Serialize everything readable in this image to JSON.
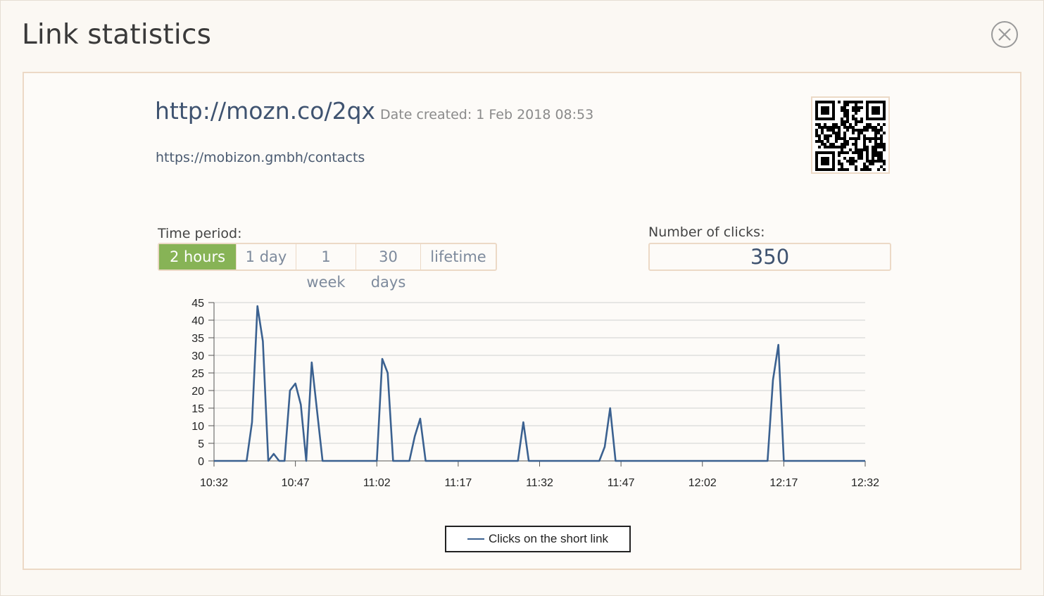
{
  "modal": {
    "title": "Link statistics"
  },
  "link": {
    "short_url": "http://mozn.co/2qx",
    "date_created": "Date created: 1 Feb 2018 08:53",
    "long_url": "https://mobizon.gmbh/contacts"
  },
  "period": {
    "label": "Time period:",
    "options": [
      "2 hours",
      "1 day",
      "1 week",
      "30 days",
      "lifetime"
    ],
    "selected": "2 hours"
  },
  "clicks": {
    "label": "Number of clicks:",
    "value": "350"
  },
  "icons": {
    "close": "close-icon",
    "qr": "qr-code-icon"
  },
  "colors": {
    "accent_green": "#87b356",
    "series": "#3b6190",
    "panel_border": "#ecd9c6"
  },
  "chart_data": {
    "type": "line",
    "x_ticks": [
      "10:32",
      "10:47",
      "11:02",
      "11:17",
      "11:32",
      "11:47",
      "12:02",
      "12:17",
      "12:32"
    ],
    "y_ticks": [
      0,
      5,
      10,
      15,
      20,
      25,
      30,
      35,
      40,
      45
    ],
    "xlim": [
      "10:32",
      "12:32"
    ],
    "ylim": [
      0,
      45
    ],
    "grid": true,
    "legend_position": "bottom-center",
    "series": [
      {
        "name": "Clicks on the short link",
        "color": "#3b6190",
        "points": [
          [
            "10:32",
            0
          ],
          [
            "10:38",
            0
          ],
          [
            "10:39",
            11
          ],
          [
            "10:40",
            44
          ],
          [
            "10:41",
            34
          ],
          [
            "10:42",
            0
          ],
          [
            "10:43",
            2
          ],
          [
            "10:44",
            0
          ],
          [
            "10:45",
            0
          ],
          [
            "10:46",
            20
          ],
          [
            "10:47",
            22
          ],
          [
            "10:48",
            16
          ],
          [
            "10:49",
            0
          ],
          [
            "10:50",
            28
          ],
          [
            "10:51",
            14
          ],
          [
            "10:52",
            0
          ],
          [
            "11:02",
            0
          ],
          [
            "11:03",
            29
          ],
          [
            "11:04",
            25
          ],
          [
            "11:05",
            0
          ],
          [
            "11:08",
            0
          ],
          [
            "11:09",
            7
          ],
          [
            "11:10",
            12
          ],
          [
            "11:11",
            0
          ],
          [
            "11:28",
            0
          ],
          [
            "11:29",
            11
          ],
          [
            "11:30",
            0
          ],
          [
            "11:43",
            0
          ],
          [
            "11:44",
            4
          ],
          [
            "11:45",
            15
          ],
          [
            "11:46",
            0
          ],
          [
            "12:14",
            0
          ],
          [
            "12:15",
            23
          ],
          [
            "12:16",
            33
          ],
          [
            "12:17",
            0
          ],
          [
            "12:32",
            0
          ]
        ]
      }
    ]
  }
}
